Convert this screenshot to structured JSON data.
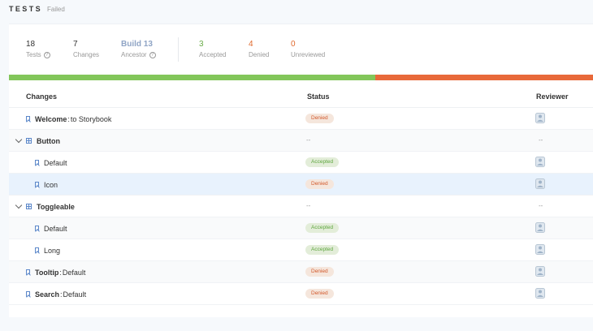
{
  "header": {
    "title": "TESTS",
    "status": "Failed"
  },
  "stats": [
    {
      "num": "18",
      "label": "Tests",
      "help": true,
      "color": "dark"
    },
    {
      "num": "7",
      "label": "Changes",
      "help": false,
      "color": "dark"
    },
    {
      "num": "Build 13",
      "label": "Ancestor",
      "help": true,
      "color": "blue"
    },
    {
      "num": "3",
      "label": "Accepted",
      "help": false,
      "color": "green"
    },
    {
      "num": "4",
      "label": "Denied",
      "help": false,
      "color": "orange"
    },
    {
      "num": "0",
      "label": "Unreviewed",
      "help": false,
      "color": "orange"
    }
  ],
  "progress": {
    "accepted_fraction": 0.627,
    "accepted_color": "#82c65a",
    "denied_color": "#e8693a"
  },
  "columns": {
    "changes": "Changes",
    "status": "Status",
    "reviewer": "Reviewer"
  },
  "rows": [
    {
      "kind": "story",
      "component": "Welcome",
      "sep": ":",
      "story": "to Storybook",
      "status": "Denied",
      "reviewer": "avatar"
    },
    {
      "kind": "group",
      "component": "Button",
      "status": "--",
      "reviewer": "--"
    },
    {
      "kind": "child",
      "story": "Default",
      "status": "Accepted",
      "reviewer": "avatar"
    },
    {
      "kind": "child",
      "story": "Icon",
      "status": "Denied",
      "reviewer": "avatar",
      "selected": true
    },
    {
      "kind": "group",
      "component": "Toggleable",
      "status": "--",
      "reviewer": "--"
    },
    {
      "kind": "child",
      "story": "Default",
      "status": "Accepted",
      "reviewer": "avatar"
    },
    {
      "kind": "child",
      "story": "Long",
      "status": "Accepted",
      "reviewer": "avatar"
    },
    {
      "kind": "story",
      "component": "Tooltip",
      "sep": ":",
      "story": "Default",
      "status": "Denied",
      "reviewer": "avatar"
    },
    {
      "kind": "story",
      "component": "Search",
      "sep": ":",
      "story": "Default",
      "status": "Denied",
      "reviewer": "avatar"
    }
  ]
}
